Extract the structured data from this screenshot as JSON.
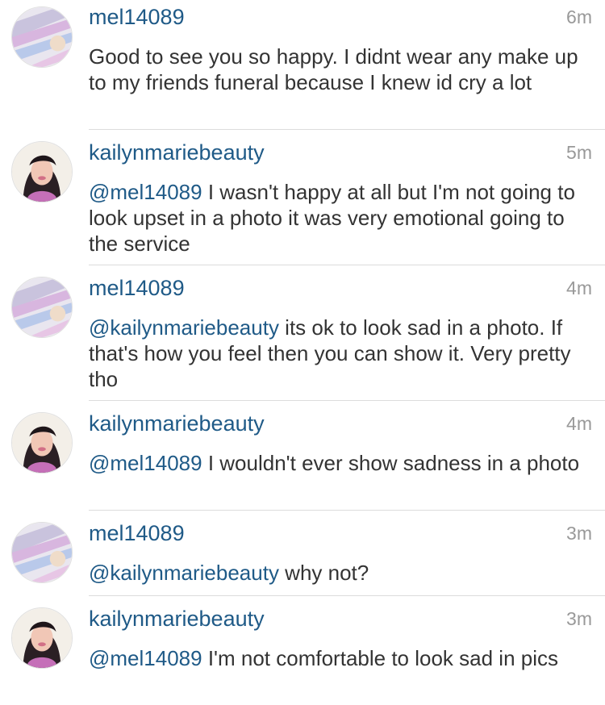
{
  "comments": [
    {
      "username": "mel14089",
      "time": "6m",
      "mention": "",
      "text": "Good to see you so happy. I didnt wear any make up to my friends funeral because I knew id cry a lot"
    },
    {
      "username": "kailynmariebeauty",
      "time": "5m",
      "mention": "@mel14089",
      "text": " I wasn't happy at all but I'm not going to look upset in a photo it was very emotional going to the service"
    },
    {
      "username": "mel14089",
      "time": "4m",
      "mention": "@kailynmariebeauty",
      "text": " its ok to look sad in a photo. If that's how you feel then you can show it. Very pretty tho"
    },
    {
      "username": "kailynmariebeauty",
      "time": "4m",
      "mention": "@mel14089",
      "text": " I wouldn't ever show sadness in a photo"
    },
    {
      "username": "mel14089",
      "time": "3m",
      "mention": "@kailynmariebeauty",
      "text": " why not?"
    },
    {
      "username": "kailynmariebeauty",
      "time": "3m",
      "mention": "@mel14089",
      "text": " I'm not comfortable to look sad in pics"
    }
  ],
  "colors": {
    "username": "#1f5a87",
    "timestamp": "#999999",
    "text": "#333333",
    "divider": "#dcdcdc"
  }
}
